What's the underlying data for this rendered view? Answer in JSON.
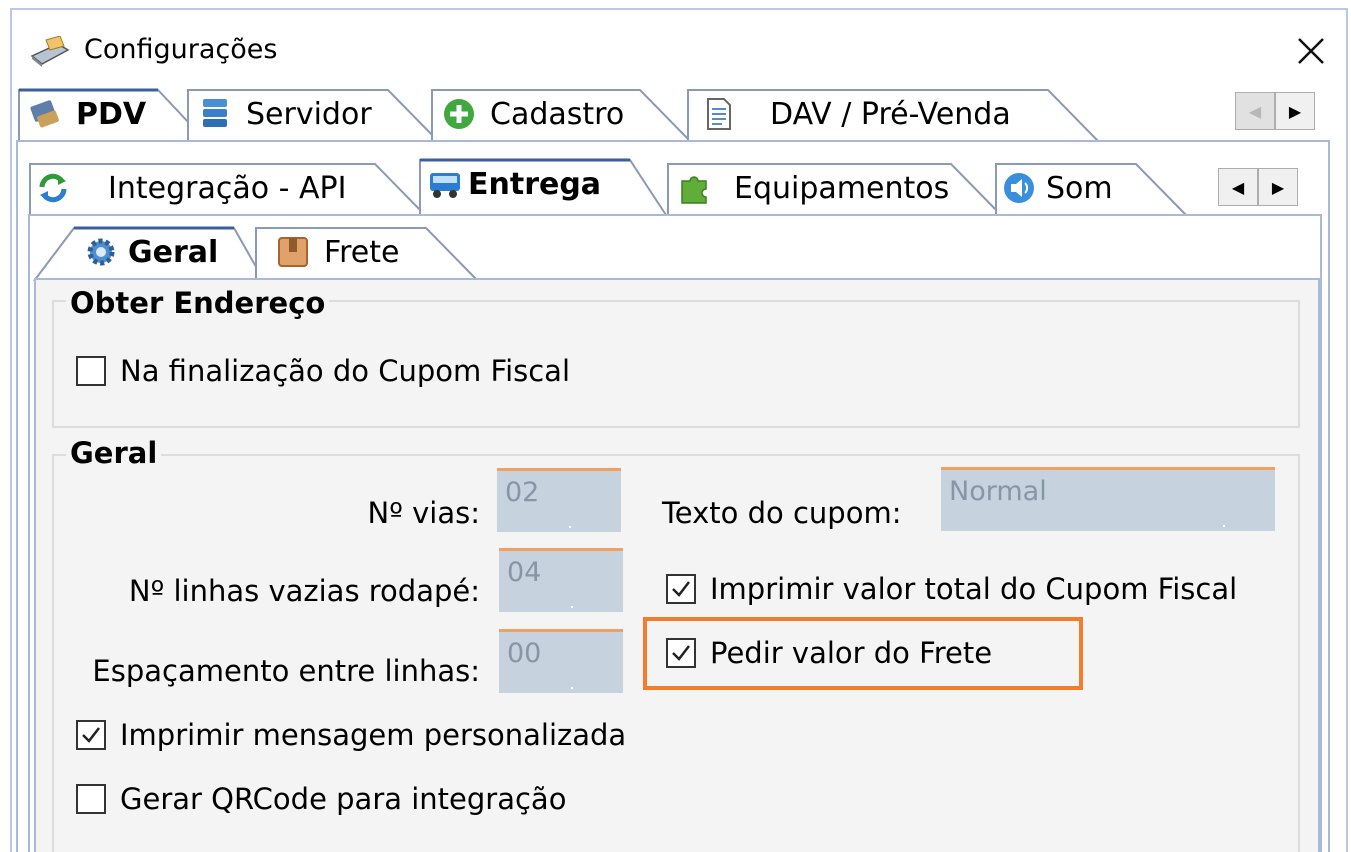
{
  "window": {
    "title": "Configurações",
    "close_label": "✕"
  },
  "tabs_row1": [
    {
      "label": "PDV",
      "icon": "pdv-icon",
      "active": true
    },
    {
      "label": "Servidor",
      "icon": "database-icon",
      "active": false
    },
    {
      "label": "Cadastro",
      "icon": "add-icon",
      "active": false
    },
    {
      "label": "DAV / Pré-Venda",
      "icon": "document-icon",
      "active": false
    }
  ],
  "tabs_row2": [
    {
      "label": "Integração - API",
      "icon": "sync-icon",
      "active": false
    },
    {
      "label": "Entrega",
      "icon": "truck-icon",
      "active": true
    },
    {
      "label": "Equipamentos",
      "icon": "puzzle-icon",
      "active": false
    },
    {
      "label": "Som",
      "icon": "speaker-icon",
      "active": false
    }
  ],
  "tabs_row3": [
    {
      "label": "Geral",
      "icon": "gear-icon",
      "active": true
    },
    {
      "label": "Frete",
      "icon": "box-icon",
      "active": false
    }
  ],
  "nav": {
    "prev": "◀",
    "next": "▶"
  },
  "obter_endereco": {
    "title": "Obter Endereço",
    "na_finalizacao": {
      "label": "Na finalização do Cupom Fiscal",
      "checked": false
    }
  },
  "geral": {
    "title": "Geral",
    "n_vias": {
      "label": "Nº vias:",
      "value": "02"
    },
    "n_linhas": {
      "label": "Nº linhas vazias rodapé:",
      "value": "04"
    },
    "espacamento": {
      "label": "Espaçamento entre linhas:",
      "value": "00"
    },
    "texto_cupom": {
      "label": "Texto do cupom:",
      "value": "Normal"
    },
    "imprimir_valor_total": {
      "label": "Imprimir valor total do Cupom Fiscal",
      "checked": true
    },
    "pedir_valor_frete": {
      "label": "Pedir valor do Frete",
      "checked": true
    },
    "imprimir_mensagem": {
      "label": "Imprimir mensagem personalizada",
      "checked": true
    },
    "gerar_qrcode": {
      "label": "Gerar QRCode para integração",
      "checked": false
    }
  },
  "colors": {
    "highlight": "#f47d2c",
    "field_bg": "#c6d2de",
    "field_accent": "#f0a060",
    "tab_border": "#a9b9d6"
  }
}
